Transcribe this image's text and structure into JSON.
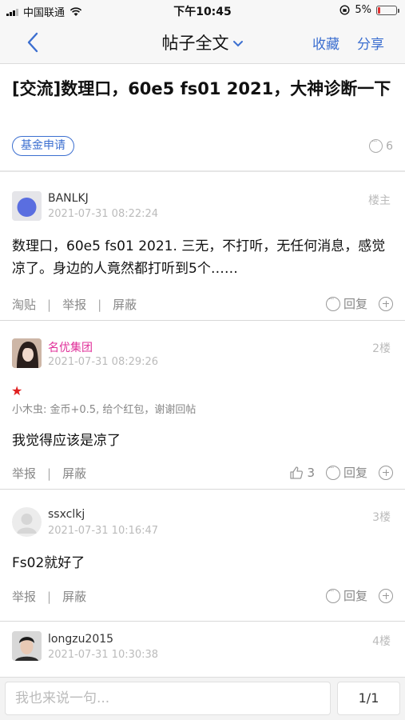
{
  "status_bar": {
    "carrier": "中国联通",
    "time": "下午10:45",
    "battery": "5%"
  },
  "nav": {
    "title": "帖子全文",
    "favorite": "收藏",
    "share": "分享"
  },
  "thread": {
    "title": "[交流]数理口，60e5 fs01 2021，大神诊断一下",
    "tag": "基金申请",
    "reply_count": "6"
  },
  "posts": [
    {
      "username": "BANLKJ",
      "time": "2021-07-31 08:22:24",
      "floor": "楼主",
      "content": "数理口，60e5 fs01 2021. 三无，不打听，无任何消息，感觉凉了。身边的人竟然都打听到5个……",
      "actions": [
        "淘贴",
        "举报",
        "屏蔽"
      ],
      "reply": "回复"
    },
    {
      "username": "名优集团",
      "time": "2021-07-31 08:29:26",
      "floor": "2楼",
      "star": "★",
      "note": "小木虫: 金币+0.5, 给个红包，谢谢回帖",
      "content": "我觉得应该是凉了",
      "actions": [
        "举报",
        "屏蔽"
      ],
      "likes": "3",
      "reply": "回复"
    },
    {
      "username": "ssxclkj",
      "time": "2021-07-31 10:16:47",
      "floor": "3楼",
      "content": "Fs02就好了",
      "actions": [
        "举报",
        "屏蔽"
      ],
      "reply": "回复"
    },
    {
      "username": "longzu2015",
      "time": "2021-07-31 10:30:38",
      "floor": "4楼"
    }
  ],
  "bottom": {
    "placeholder": "我也来说一句...",
    "pager": "1/1"
  },
  "colors": {
    "accent": "#3c6fd0",
    "vip_name": "#e0309a",
    "star": "#e02020"
  }
}
